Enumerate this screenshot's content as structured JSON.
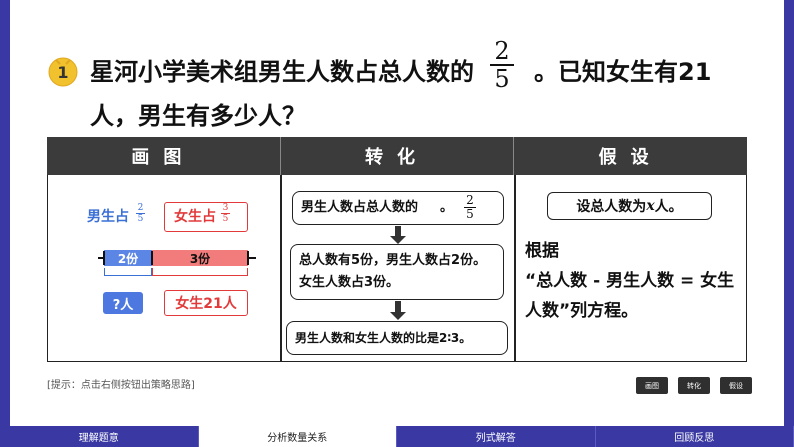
{
  "question": {
    "number": "1",
    "line1_before": "星河小学美术组男生人数占总人数的",
    "fraction": {
      "numerator": "2",
      "denominator": "5"
    },
    "line1_after": "。已知女生有21",
    "line2": "人，男生有多少人？"
  },
  "table": {
    "headers": [
      "画图",
      "转化",
      "假设"
    ]
  },
  "diagram": {
    "boy_label": "男生占",
    "boy_fraction": {
      "numerator": "2",
      "denominator": "5"
    },
    "girl_label": "女生占",
    "girl_fraction": {
      "numerator": "3",
      "denominator": "5"
    },
    "seg_boy": "2份",
    "seg_girl": "3份",
    "boy_unknown": "?人",
    "girl_count": "女生21人"
  },
  "convert": {
    "step1_before": "男生人数占总人数的",
    "step1_fraction": {
      "numerator": "2",
      "denominator": "5"
    },
    "step1_after": "。",
    "step2_line1": "总人数有5份，男生人数占2份。",
    "step2_line2": "女生人数占3份。",
    "step3": "男生人数和女生人数的比是2∶3。"
  },
  "assume": {
    "box_before": "设总人数为",
    "box_var": "x",
    "box_after": "人。",
    "text_line1": "根据",
    "text_line2": "“总人数 - 男生人数 = 女生",
    "text_line3": "人数”列方程。"
  },
  "hint": "[提示：点击右侧按钮出策略思路]",
  "buttons": [
    "画图",
    "转化",
    "假设"
  ],
  "nav": [
    "理解题意",
    "分析数量关系",
    "列式解答",
    "回顾反思"
  ],
  "colors": {
    "frame": "#3a39a3",
    "header": "#3b3b3b",
    "boy": "#3a6fd6",
    "girl": "#e23a3a",
    "badge": "#f2c12e"
  }
}
